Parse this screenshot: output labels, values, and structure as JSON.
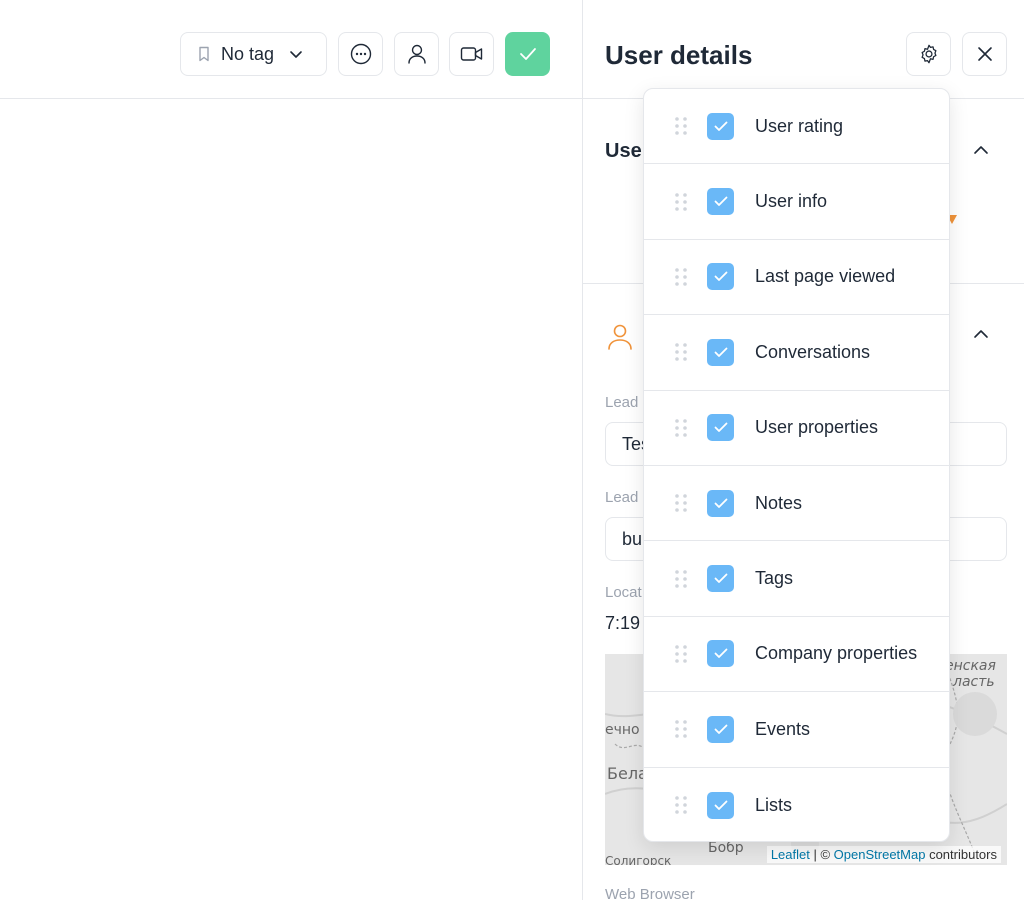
{
  "toolbar": {
    "tag_label": "No tag",
    "resolve_color": "#5fd39e"
  },
  "panel": {
    "title": "User details",
    "section1_title_visible": "Use",
    "lead1_label_visible": "Lead",
    "lead1_value_visible": "Tes",
    "lead2_label_visible": "Lead",
    "lead2_value_visible": "bu",
    "local_label_visible": "Locat",
    "local_time_visible": "7:19",
    "web_browser_label": "Web Browser"
  },
  "map": {
    "attribution_leaflet": "Leaflet",
    "attribution_sep": " | © ",
    "attribution_osm": "OpenStreetMap",
    "attribution_tail": " contributors",
    "labels": [
      "енская",
      "ласть",
      "ечно",
      "Бела",
      "Бобр",
      "Солигорск"
    ]
  },
  "dropdown": {
    "items": [
      {
        "label": "User rating",
        "checked": true
      },
      {
        "label": "User info",
        "checked": true
      },
      {
        "label": "Last page viewed",
        "checked": true
      },
      {
        "label": "Conversations",
        "checked": true
      },
      {
        "label": "User properties",
        "checked": true
      },
      {
        "label": "Notes",
        "checked": true
      },
      {
        "label": "Tags",
        "checked": true
      },
      {
        "label": "Company properties",
        "checked": true
      },
      {
        "label": "Events",
        "checked": true
      },
      {
        "label": "Lists",
        "checked": true
      }
    ],
    "check_color": "#6ab8f7"
  },
  "colors": {
    "accent_orange": "#f0933a",
    "border": "#e5e7eb"
  }
}
